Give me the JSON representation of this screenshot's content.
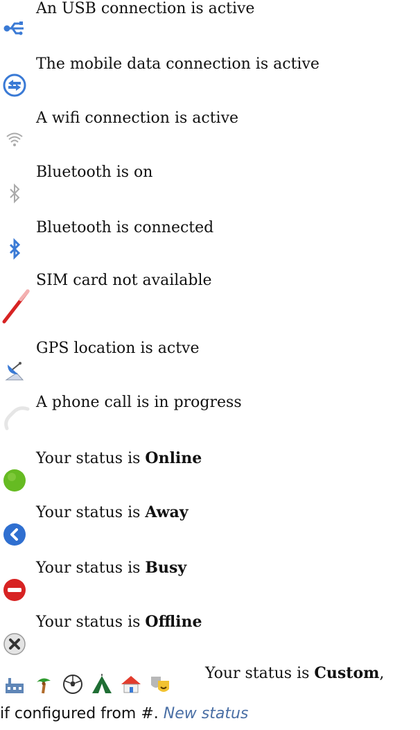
{
  "rows": [
    {
      "text": "An USB connection is active",
      "icon": "usb-icon"
    },
    {
      "text": "The mobile data connection is active",
      "icon": "mobile-data-icon"
    },
    {
      "text": "A wifi connection is active",
      "icon": "wifi-icon"
    },
    {
      "text": "Bluetooth is on",
      "icon": "bluetooth-on-icon"
    },
    {
      "text": "Bluetooth is connected",
      "icon": "bluetooth-connected-icon"
    },
    {
      "text": "SIM card not available",
      "icon": "sim-unavailable-icon"
    },
    {
      "text": "GPS location is actve",
      "icon": "gps-icon"
    },
    {
      "text": "A phone call is in progress",
      "icon": "phone-call-icon"
    }
  ],
  "status": {
    "prefix": "Your status is ",
    "online": "Online",
    "away": "Away",
    "busy": "Busy",
    "offline": "Offline",
    "custom": "Custom",
    "custom_suffix": ","
  },
  "custom_icons": [
    "factory-icon",
    "palm-tree-icon",
    "soccer-ball-icon",
    "tent-icon",
    "house-icon",
    "theater-masks-icon"
  ],
  "footer": {
    "text": "if configured from #. ",
    "link": "New status"
  },
  "colors": {
    "blue": "#3a7ad5",
    "green": "#66bb22",
    "red": "#d72323",
    "gray": "#aaaaaa",
    "link": "#4a6fa5"
  }
}
